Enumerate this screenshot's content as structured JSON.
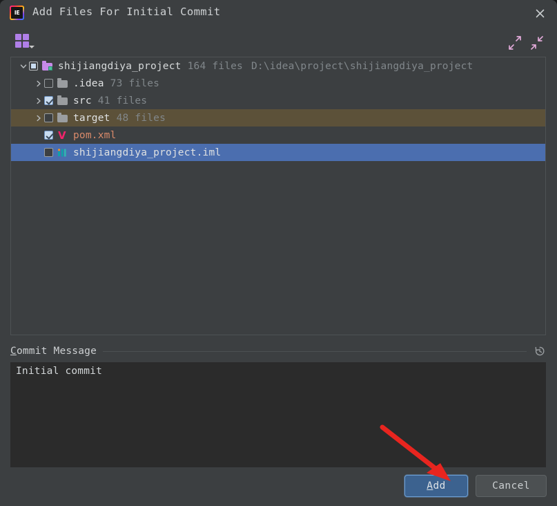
{
  "window": {
    "title": "Add Files For Initial Commit",
    "app_icon": "intellij-idea-icon",
    "app_icon_text": "IE",
    "close_icon": "close-icon"
  },
  "toolbar": {
    "group_by_icon": "group-by-grid-icon",
    "expand_all_icon": "expand-all-icon",
    "collapse_all_icon": "collapse-all-icon",
    "accent_color": "#b07fe8"
  },
  "tree": {
    "nodes": [
      {
        "name": "shijiangdiya_project",
        "count": "164 files",
        "path": "D:\\idea\\project\\shijiangdiya_project",
        "indent": 0,
        "twisty": "expanded",
        "checkbox": "indeterminate",
        "icon": "module-folder-icon",
        "state": "normal"
      },
      {
        "name": ".idea",
        "count": "73 files",
        "path": "",
        "indent": 1,
        "twisty": "collapsed",
        "checkbox": "unchecked",
        "icon": "folder-icon",
        "state": "normal"
      },
      {
        "name": "src",
        "count": "41 files",
        "path": "",
        "indent": 1,
        "twisty": "collapsed",
        "checkbox": "checked",
        "icon": "folder-icon",
        "state": "normal"
      },
      {
        "name": "target",
        "count": "48 files",
        "path": "",
        "indent": 1,
        "twisty": "collapsed",
        "checkbox": "unchecked",
        "icon": "folder-icon",
        "state": "hovered"
      },
      {
        "name": "pom.xml",
        "count": "",
        "path": "",
        "indent": 1,
        "twisty": "none",
        "checkbox": "checked",
        "icon": "maven-file-icon",
        "state": "normal"
      },
      {
        "name": "shijiangdiya_project.iml",
        "count": "",
        "path": "",
        "indent": 1,
        "twisty": "none",
        "checkbox": "unchecked",
        "icon": "iml-module-file-icon",
        "state": "selected"
      }
    ]
  },
  "commit": {
    "label_mnemonic": "C",
    "label_rest": "ommit Message",
    "history_icon": "history-clock-icon",
    "message": "Initial commit"
  },
  "buttons": {
    "add_mnemonic": "A",
    "add_rest": "dd",
    "cancel_label": "Cancel"
  },
  "annotation": {
    "arrow_icon": "red-pointer-arrow",
    "color": "#e8251f"
  }
}
